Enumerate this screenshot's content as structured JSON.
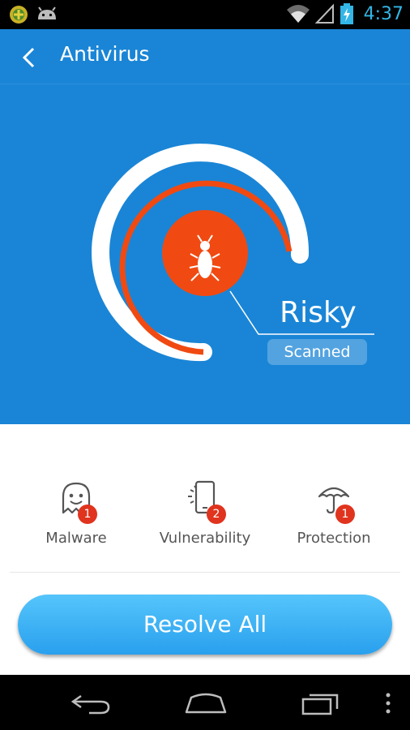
{
  "status_bar": {
    "time": "4:37"
  },
  "app_bar": {
    "title": "Antivirus"
  },
  "scan": {
    "status": "Risky",
    "badge": "Scanned"
  },
  "categories": [
    {
      "label": "Malware",
      "count": "1",
      "icon": "ghost-icon"
    },
    {
      "label": "Vulnerability",
      "count": "2",
      "icon": "phone-crack-icon"
    },
    {
      "label": "Protection",
      "count": "1",
      "icon": "umbrella-icon"
    }
  ],
  "resolve_button": {
    "label": "Resolve All"
  },
  "colors": {
    "header_blue": "#1a85d6",
    "alert_red": "#f04a12",
    "badge_red": "#e0341e",
    "clock_blue": "#33b5e5"
  }
}
